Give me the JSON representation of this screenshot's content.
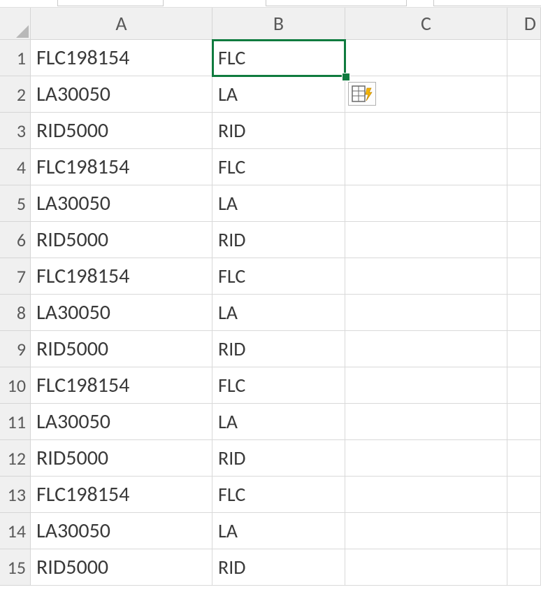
{
  "columns": [
    "A",
    "B",
    "C",
    "D"
  ],
  "rows": [
    {
      "n": "1",
      "A": "FLC198154",
      "B": "FLC"
    },
    {
      "n": "2",
      "A": "LA30050",
      "B": "LA"
    },
    {
      "n": "3",
      "A": "RID5000",
      "B": "RID"
    },
    {
      "n": "4",
      "A": "FLC198154",
      "B": "FLC"
    },
    {
      "n": "5",
      "A": "LA30050",
      "B": "LA"
    },
    {
      "n": "6",
      "A": "RID5000",
      "B": "RID"
    },
    {
      "n": "7",
      "A": "FLC198154",
      "B": "FLC"
    },
    {
      "n": "8",
      "A": "LA30050",
      "B": "LA"
    },
    {
      "n": "9",
      "A": "RID5000",
      "B": "RID"
    },
    {
      "n": "10",
      "A": "FLC198154",
      "B": "FLC"
    },
    {
      "n": "11",
      "A": "LA30050",
      "B": "LA"
    },
    {
      "n": "12",
      "A": "RID5000",
      "B": "RID"
    },
    {
      "n": "13",
      "A": "FLC198154",
      "B": "FLC"
    },
    {
      "n": "14",
      "A": "LA30050",
      "B": "LA"
    },
    {
      "n": "15",
      "A": "RID5000",
      "B": "RID"
    }
  ],
  "selected_cell": "B1",
  "flash_fill_icon_title": "Flash Fill Options",
  "colors": {
    "selection": "#0f7b3f"
  }
}
